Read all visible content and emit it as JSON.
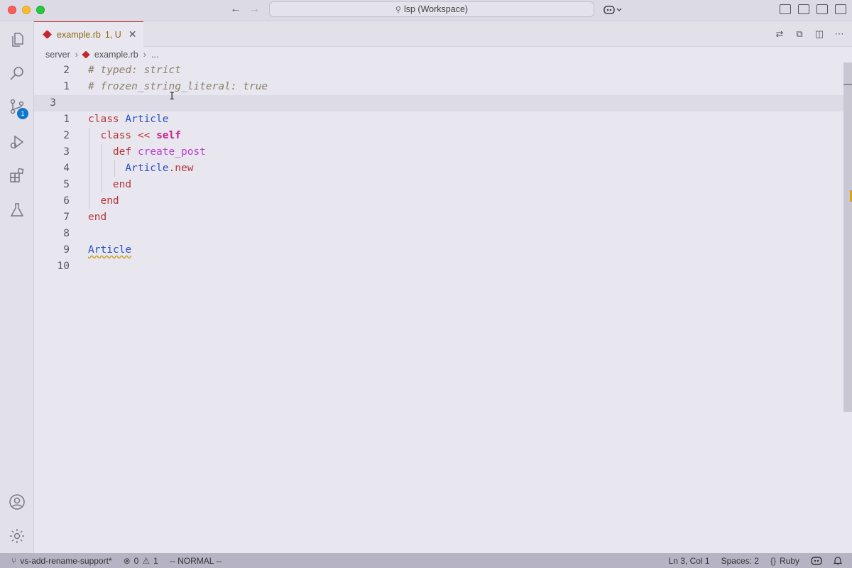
{
  "window": {
    "search_text": "lsp (Workspace)"
  },
  "tab": {
    "filename": "example.rb",
    "status": "1, U",
    "close": "✕"
  },
  "breadcrumb": {
    "folder": "server",
    "file": "example.rb",
    "more": "..."
  },
  "activity": {
    "scm_badge": "1"
  },
  "editor": {
    "lines": [
      {
        "num": "2",
        "tokens": [
          {
            "t": "# typed: strict",
            "c": "c-comment"
          }
        ]
      },
      {
        "num": "1",
        "tokens": [
          {
            "t": "# frozen_string_literal: true",
            "c": "c-comment"
          }
        ]
      },
      {
        "num": "3",
        "current": true,
        "tokens": []
      },
      {
        "num": "1",
        "tokens": [
          {
            "t": "class",
            "c": "c-kw"
          },
          {
            "t": " "
          },
          {
            "t": "Article",
            "c": "c-cls"
          }
        ]
      },
      {
        "num": "2",
        "tokens": [
          {
            "t": "  "
          },
          {
            "t": "class",
            "c": "c-kw"
          },
          {
            "t": " "
          },
          {
            "t": "<<",
            "c": "c-op"
          },
          {
            "t": " "
          },
          {
            "t": "self",
            "c": "c-self"
          }
        ]
      },
      {
        "num": "3",
        "tokens": [
          {
            "t": "    "
          },
          {
            "t": "def",
            "c": "c-kw"
          },
          {
            "t": " "
          },
          {
            "t": "create_post",
            "c": "c-fn"
          }
        ]
      },
      {
        "num": "4",
        "tokens": [
          {
            "t": "      "
          },
          {
            "t": "Article",
            "c": "c-cls"
          },
          {
            "t": ".",
            "c": "c-dot"
          },
          {
            "t": "new",
            "c": "c-kw"
          }
        ]
      },
      {
        "num": "5",
        "tokens": [
          {
            "t": "    "
          },
          {
            "t": "end",
            "c": "c-kw"
          }
        ]
      },
      {
        "num": "6",
        "tokens": [
          {
            "t": "  "
          },
          {
            "t": "end",
            "c": "c-kw"
          }
        ]
      },
      {
        "num": "7",
        "tokens": [
          {
            "t": "end",
            "c": "c-kw"
          }
        ]
      },
      {
        "num": "8",
        "tokens": []
      },
      {
        "num": "9",
        "tokens": [
          {
            "t": "Article",
            "c": "c-cls squiggle"
          }
        ]
      },
      {
        "num": "10",
        "tokens": []
      }
    ]
  },
  "statusbar": {
    "branch": "vs-add-rename-support*",
    "errors": "0",
    "warnings": "1",
    "mode": "-- NORMAL --",
    "position": "Ln 3, Col 1",
    "spaces": "Spaces: 2",
    "language": "Ruby"
  },
  "colors": {
    "accent_badge": "#1177cc",
    "ruby_icon": "#c1282d",
    "statusbar": "#b6b4c4"
  }
}
